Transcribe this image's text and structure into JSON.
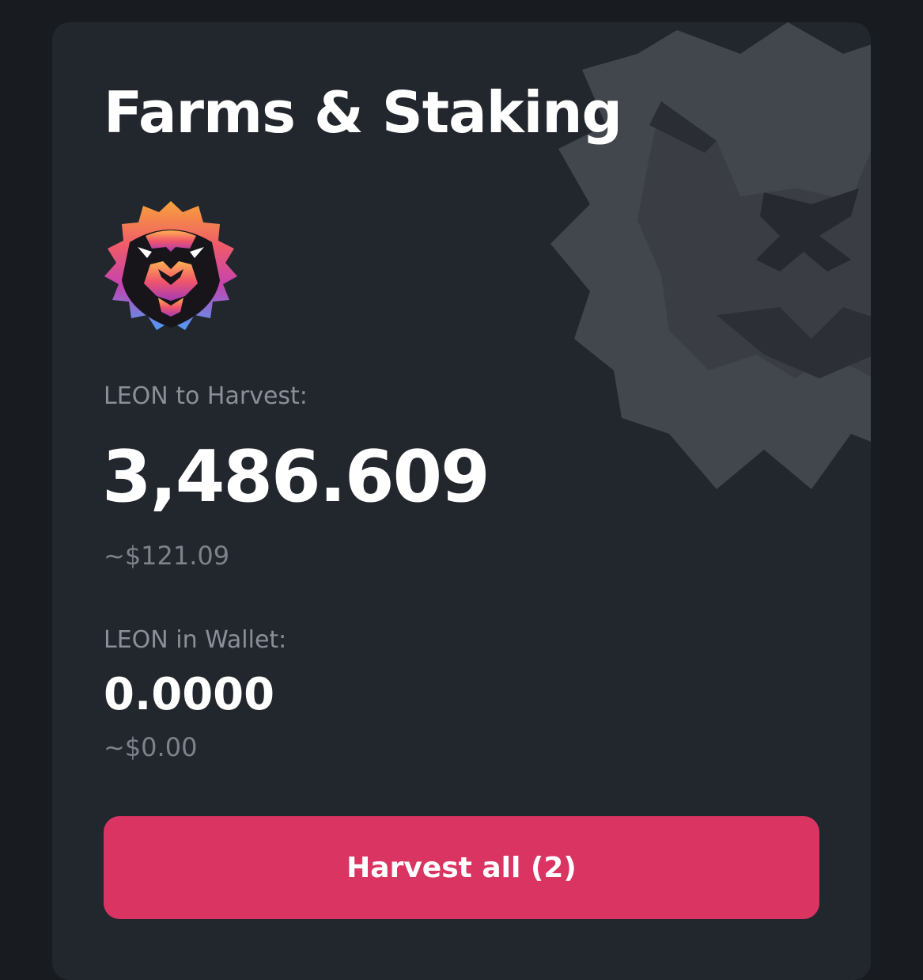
{
  "page": {
    "title": "Farms & Staking"
  },
  "harvest": {
    "label": "LEON to Harvest:",
    "amount": "3,486.609",
    "usd": "~$121.09"
  },
  "wallet": {
    "label": "LEON in Wallet:",
    "amount": "0.0000",
    "usd": "~$0.00"
  },
  "actions": {
    "harvest_all_label": "Harvest all (2)"
  },
  "icons": {
    "logo": "lion-logo-icon",
    "watermark": "lion-watermark-icon"
  },
  "colors": {
    "background": "#181b20",
    "card": "#22262d",
    "accent": "#d93462",
    "muted_text": "#8a8f98"
  }
}
